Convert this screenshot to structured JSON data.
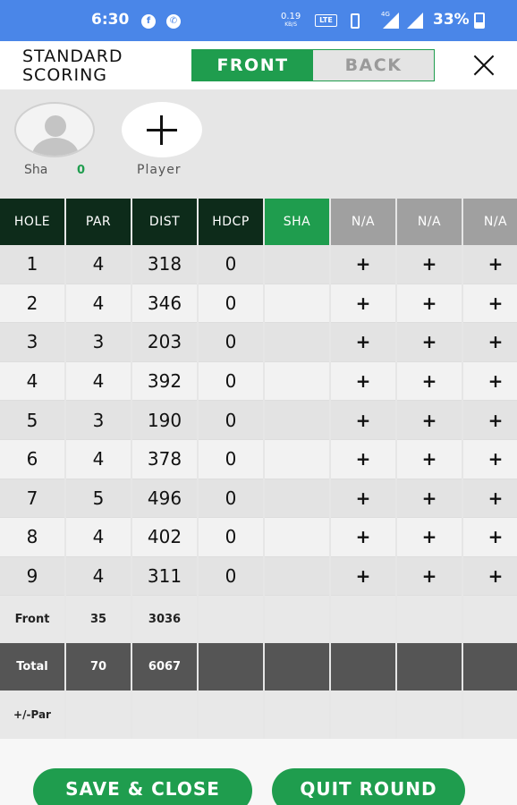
{
  "status_bar": {
    "time": "6:30",
    "speed_value": "0.19",
    "speed_unit": "KB/S",
    "network_badge": "VoLTE",
    "signal_type": "4G",
    "battery": "33%"
  },
  "header": {
    "title_line1": "STANDARD",
    "title_line2": "SCORING",
    "tab_front": "FRONT",
    "tab_back": "BACK",
    "active_tab": "FRONT"
  },
  "players": [
    {
      "name": "Sha",
      "score": "0"
    }
  ],
  "add_player_label": "Player",
  "table": {
    "headers": [
      "HOLE",
      "PAR",
      "DIST",
      "HDCP",
      "SHA",
      "N/A",
      "N/A",
      "N/A"
    ],
    "holes": [
      {
        "hole": "1",
        "par": "4",
        "dist": "318",
        "hdcp": "0"
      },
      {
        "hole": "2",
        "par": "4",
        "dist": "346",
        "hdcp": "0"
      },
      {
        "hole": "3",
        "par": "3",
        "dist": "203",
        "hdcp": "0"
      },
      {
        "hole": "4",
        "par": "4",
        "dist": "392",
        "hdcp": "0"
      },
      {
        "hole": "5",
        "par": "3",
        "dist": "190",
        "hdcp": "0"
      },
      {
        "hole": "6",
        "par": "4",
        "dist": "378",
        "hdcp": "0"
      },
      {
        "hole": "7",
        "par": "5",
        "dist": "496",
        "hdcp": "0"
      },
      {
        "hole": "8",
        "par": "4",
        "dist": "402",
        "hdcp": "0"
      },
      {
        "hole": "9",
        "par": "4",
        "dist": "311",
        "hdcp": "0"
      }
    ],
    "add_symbol": "+",
    "front": {
      "label": "Front",
      "par": "35",
      "dist": "3036"
    },
    "total": {
      "label": "Total",
      "par": "70",
      "dist": "6067"
    },
    "plus_minus_label": "+/-Par"
  },
  "footer": {
    "save_close": "SAVE & CLOSE",
    "quit_round": "QUIT ROUND"
  },
  "colors": {
    "status_bar": "#4a86e8",
    "accent_green": "#1f9d4e",
    "header_dark": "#0d2b1a",
    "header_gray": "#a0a0a0",
    "total_row": "#555555"
  }
}
